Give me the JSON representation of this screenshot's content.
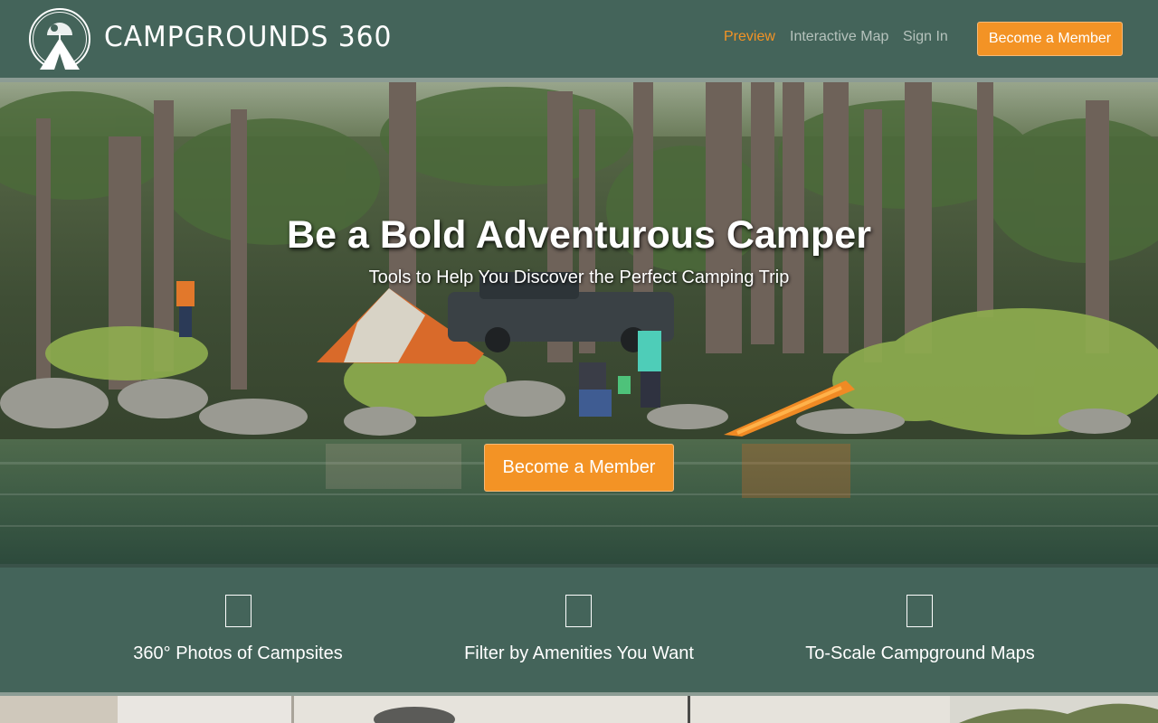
{
  "header": {
    "brand": "CAMPGROUNDS 360",
    "nav": {
      "preview": "Preview",
      "interactive_map": "Interactive Map",
      "sign_in": "Sign In"
    },
    "cta": "Become a Member"
  },
  "hero": {
    "title": "Be a Bold Adventurous Camper",
    "subtitle": "Tools to Help You Discover the Perfect Camping Trip",
    "cta": "Become a Member"
  },
  "features": [
    {
      "icon": "photo-360-icon",
      "label": "360° Photos of Campsites"
    },
    {
      "icon": "filter-icon",
      "label": "Filter by Amenities You Want"
    },
    {
      "icon": "map-icon",
      "label": "To-Scale Campground Maps"
    }
  ],
  "colors": {
    "brand_green": "#44645a",
    "accent_orange": "#f39325",
    "nav_muted": "#b5c2bc"
  }
}
